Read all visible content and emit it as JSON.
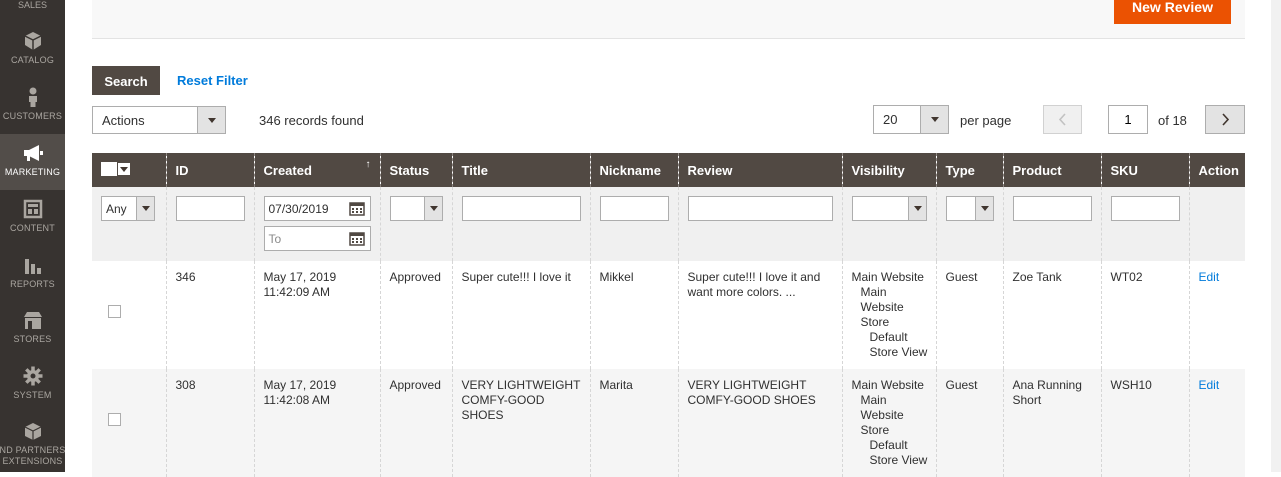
{
  "sidebar": {
    "top_partial": "SALES",
    "items": [
      {
        "label": "CATALOG",
        "icon": "cube-icon"
      },
      {
        "label": "CUSTOMERS",
        "icon": "person-icon"
      },
      {
        "label": "MARKETING",
        "icon": "megaphone-icon"
      },
      {
        "label": "CONTENT",
        "icon": "layout-icon"
      },
      {
        "label": "REPORTS",
        "icon": "bar-chart-icon"
      },
      {
        "label": "STORES",
        "icon": "storefront-icon"
      },
      {
        "label": "SYSTEM",
        "icon": "gear-icon"
      },
      {
        "label": "ND PARTNERS",
        "label2": "EXTENSIONS",
        "icon": "box-icon"
      }
    ]
  },
  "header": {
    "new_review": "New Review"
  },
  "toolbar": {
    "search": "Search",
    "reset_filter": "Reset Filter",
    "actions": "Actions",
    "records_found": "346 records found",
    "per_page_value": "20",
    "per_page_label": "per page",
    "current_page": "1",
    "of_pages": "of 18"
  },
  "table": {
    "headers": [
      "ID",
      "Created",
      "Status",
      "Title",
      "Nickname",
      "Review",
      "Visibility",
      "Type",
      "Product",
      "SKU",
      "Action"
    ],
    "filters": {
      "mass": "Any",
      "created_from": "07/30/2019",
      "created_to_placeholder": "To"
    },
    "rows": [
      {
        "id": "346",
        "created_date": "May 17, 2019",
        "created_time": "11:42:09 AM",
        "status": "Approved",
        "title": "Super cute!!! I love it",
        "nickname": "Mikkel",
        "review": "Super cute!!! I love it and want more colors. ...",
        "visibility_1": "Main Website",
        "visibility_2": "Main Website Store",
        "visibility_3": "Default Store View",
        "type": "Guest",
        "product": "Zoe Tank",
        "sku": "WT02",
        "action": "Edit"
      },
      {
        "id": "308",
        "created_date": "May 17, 2019",
        "created_time": "11:42:08 AM",
        "status": "Approved",
        "title": "VERY LIGHTWEIGHT COMFY-GOOD SHOES",
        "nickname": "Marita",
        "review": "VERY LIGHTWEIGHT COMFY-GOOD SHOES",
        "visibility_1": "Main Website",
        "visibility_2": "Main Website Store",
        "visibility_3": "Default Store View",
        "type": "Guest",
        "product": "Ana Running Short",
        "sku": "WSH10",
        "action": "Edit"
      }
    ]
  },
  "colors": {
    "sidebar_bg": "#373330",
    "sidebar_active": "#524d49",
    "accent": "#eb5202",
    "header_bg": "#514943",
    "link": "#007bdb"
  }
}
